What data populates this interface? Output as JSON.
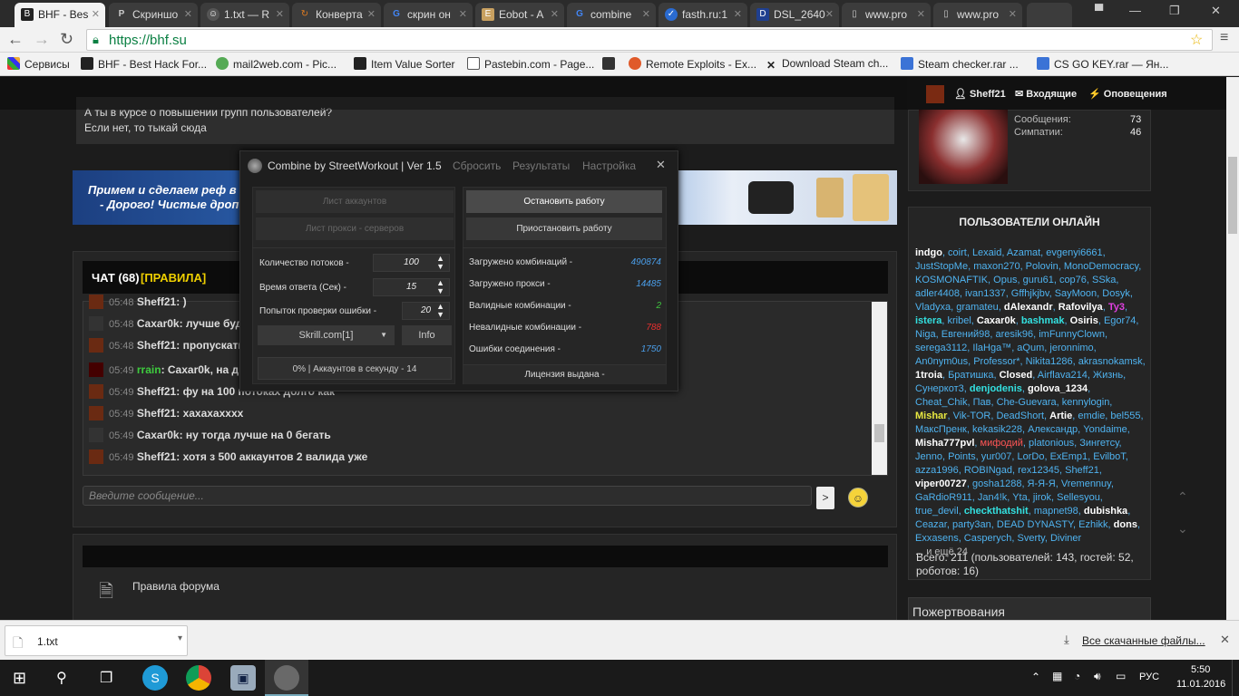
{
  "tabs": [
    {
      "label": "BHF - Bes",
      "icon": "bhf-icon",
      "active": true
    },
    {
      "label": "Скриншо",
      "icon": "p-icon"
    },
    {
      "label": "1.txt — R",
      "icon": "robot-icon"
    },
    {
      "label": "Конверта",
      "icon": "convert-icon"
    },
    {
      "label": "скрин он",
      "icon": "google-icon"
    },
    {
      "label": "Eobot - A",
      "icon": "eobot-icon"
    },
    {
      "label": "combine",
      "icon": "google-icon"
    },
    {
      "label": "fasth.ru:1",
      "icon": "fasth-icon"
    },
    {
      "label": "DSL_2640",
      "icon": "dlink-icon"
    },
    {
      "label": "www.pro",
      "icon": "page-icon"
    },
    {
      "label": "www.pro",
      "icon": "page-icon"
    }
  ],
  "url": "https://bhf.su",
  "bookmarks": [
    {
      "label": "Сервисы",
      "icon": "apps-icon"
    },
    {
      "label": "BHF - Best Hack For...",
      "icon": "bhf-icon"
    },
    {
      "label": "mail2web.com - Pic...",
      "icon": "mail2web-icon"
    },
    {
      "label": "Item Value Sorter",
      "icon": "s-icon"
    },
    {
      "label": "Pastebin.com - Page...",
      "icon": "pastebin-icon"
    },
    {
      "label": "",
      "icon": "fp-icon"
    },
    {
      "label": "Remote Exploits - Ex...",
      "icon": "exploit-icon"
    },
    {
      "label": "Download Steam ch...",
      "icon": "x-icon"
    },
    {
      "label": "Steam checker.rar ...",
      "icon": "yadisk-icon"
    },
    {
      "label": "CS GO KEY.rar — Ян...",
      "icon": "yadisk-icon"
    }
  ],
  "topnav": {
    "user": "Sheff21",
    "inbox": "Входящие",
    "alerts": "Оповещения"
  },
  "infobox": {
    "line1": "А ты в курсе о повышении групп пользователей?",
    "line2": "Если нет, то тыкай сюда"
  },
  "banner": {
    "line1": "Примем и сделаем реф в",
    "line2": "- Дорого! Чистые дроп"
  },
  "chat": {
    "title": "ЧАТ (68)",
    "rules": "[ПРАВИЛА]",
    "messages": [
      {
        "time": "05:48",
        "author": "Sheff21",
        "text": ": )"
      },
      {
        "time": "05:48",
        "author": "Caxar0k",
        "text": ": лучше будет"
      },
      {
        "time": "05:48",
        "author": "Sheff21",
        "text": ": пропускать н"
      },
      {
        "time": "05:49",
        "author": "rrain",
        "text": ": Caxar0k, на двух"
      },
      {
        "time": "05:49",
        "author": "Sheff21",
        "text": ": фу на 100 потоках долго как"
      },
      {
        "time": "05:49",
        "author": "Sheff21",
        "text": ": хахахаxxxx"
      },
      {
        "time": "05:49",
        "author": "Caxar0k",
        "text": ": ну тогда лучше на 0 бегать"
      },
      {
        "time": "05:49",
        "author": "Sheff21",
        "text": ": хотя з 500 аккаунтов 2 валида уже"
      }
    ],
    "input_placeholder": "Введите сообщение...",
    "send": ">"
  },
  "rules_forum": "Правила форума",
  "profile": {
    "messages_label": "Сообщения:",
    "messages": "73",
    "likes_label": "Симпатии:",
    "likes": "46"
  },
  "online": {
    "title": "ПОЛЬЗОВАТЕЛИ ОНЛАЙН",
    "more": "... и ещё 24",
    "totals": "Всего: 211 (пользователей: 143, гостей: 52, роботов: 16)"
  },
  "donations": "Пожертвования",
  "dialog": {
    "title": "Combine by StreetWorkout | Ver 1.5",
    "menu": [
      "Сбросить",
      "Результаты",
      "Настройка"
    ],
    "close": "✕",
    "btn_accounts": "Лист аккаунтов",
    "btn_proxies": "Лист прокси - серверов",
    "btn_stop": "Остановить работу",
    "btn_pause": "Приостановить работу",
    "threads_label": "Количество потоков -",
    "threads": "100",
    "timeout_label": "Время ответа (Сек) -",
    "timeout": "15",
    "retries_label": "Попыток проверки ошибки -",
    "retries": "20",
    "service": "Skrill.com[1]",
    "info": "Info",
    "progress": "0% | Аккаунтов в секунду - 14",
    "stats": [
      {
        "label": "Загружено комбинаций -",
        "value": "490874",
        "color": "#4a9de8"
      },
      {
        "label": "Загружено прокси -",
        "value": "14485",
        "color": "#4a9de8"
      },
      {
        "label": "Валидные комбинации -",
        "value": "2",
        "color": "#3ec43e"
      },
      {
        "label": "Невалидные комбинации -",
        "value": "788",
        "color": "#e83030"
      },
      {
        "label": "Ошибки соединения -",
        "value": "1750",
        "color": "#4a9de8"
      }
    ],
    "license": "Лицензия выдана -"
  },
  "download": {
    "file": "1.txt",
    "all": "Все скачанные файлы..."
  },
  "tray": {
    "lang": "РУС",
    "time": "5:50",
    "date": "11.01.2016"
  }
}
